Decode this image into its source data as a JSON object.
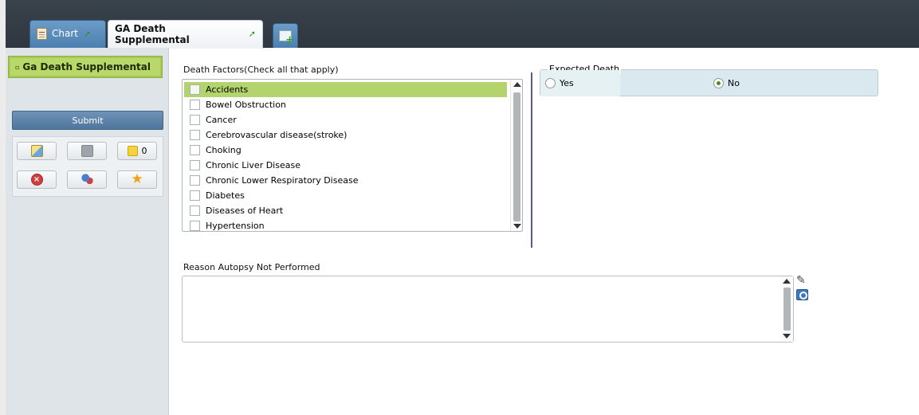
{
  "tabs": [
    {
      "label": "Chart",
      "icon": "chart-doc-icon"
    },
    {
      "label": "GA Death Supplemental",
      "icon": "pin-icon"
    },
    {
      "label": "",
      "icon": "add-form-icon"
    }
  ],
  "sidebar": {
    "item_label": "Ga Death Supplemental",
    "submit_label": "Submit",
    "tools": [
      {
        "name": "report-icon"
      },
      {
        "name": "disabled-icon"
      },
      {
        "name": "sticky-note-icon",
        "count": "0"
      },
      {
        "name": "cancel-icon"
      },
      {
        "name": "people-icon"
      },
      {
        "name": "favorite-star-icon"
      }
    ]
  },
  "death_factors": {
    "label": "Death Factors(Check all that apply)",
    "items": [
      "Accidents",
      "Bowel Obstruction",
      "Cancer",
      "Cerebrovascular disease(stroke)",
      "Choking",
      "Chronic Liver Disease",
      "Chronic Lower Respiratory Disease",
      "Diabetes",
      "Diseases of Heart",
      "Hypertension"
    ],
    "selected_index": 0
  },
  "expected_death": {
    "legend": "Expected Death",
    "yes_label": "Yes",
    "no_label": "No",
    "selected": "No"
  },
  "autopsy": {
    "label": "Reason Autopsy Not Performed",
    "value": ""
  },
  "colors": {
    "header_dark": "#333c45",
    "selection_green": "#b3d36d",
    "submit_blue": "#5a7fa6"
  }
}
